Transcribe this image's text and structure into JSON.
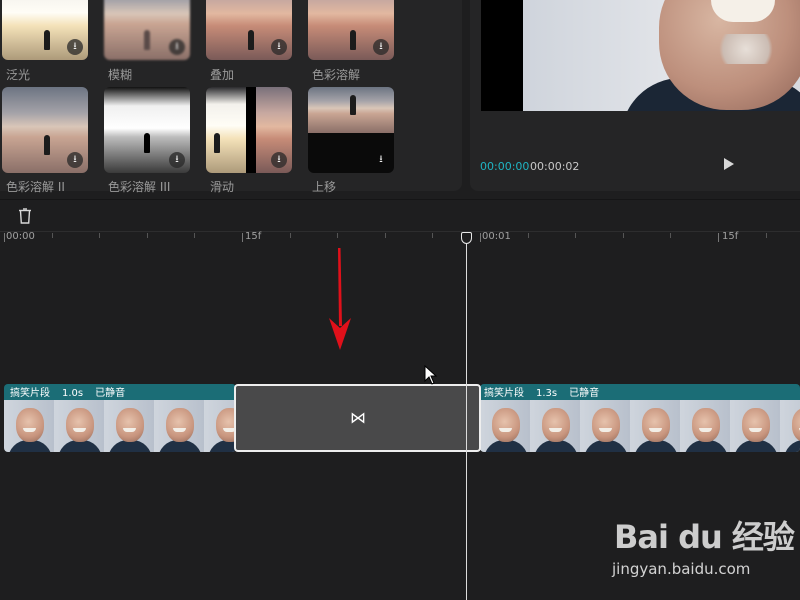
{
  "effects": {
    "items": [
      {
        "label": "泛光",
        "style": "lake-bright"
      },
      {
        "label": "模糊",
        "style": "lake"
      },
      {
        "label": "叠加",
        "style": "lake-warm"
      },
      {
        "label": "色彩溶解",
        "style": "lake-warm"
      },
      {
        "label": "色彩溶解 II",
        "style": "lake"
      },
      {
        "label": "色彩溶解 III",
        "style": "lake-mono"
      },
      {
        "label": "滑动",
        "style": "split"
      },
      {
        "label": "上移",
        "style": "shift"
      }
    ],
    "download_icon": "download-icon"
  },
  "preview": {
    "current_time": "00:00:00",
    "duration": "00:00:02",
    "accent_color": "#1fb3c2"
  },
  "toolbar": {
    "delete_icon": "trash-icon"
  },
  "ruler": {
    "labels": [
      "00:00",
      "15f",
      "00:01",
      "15f"
    ]
  },
  "timeline": {
    "clips": [
      {
        "name": "搞笑片段",
        "duration": "1.0s",
        "status": "已静音"
      },
      {
        "name": "搞笑片段",
        "duration": "1.3s",
        "status": "已静音"
      }
    ],
    "transition_symbol": "⋈"
  },
  "watermark": {
    "brand": "Bai du 经验",
    "url": "jingyan.baidu.com"
  }
}
